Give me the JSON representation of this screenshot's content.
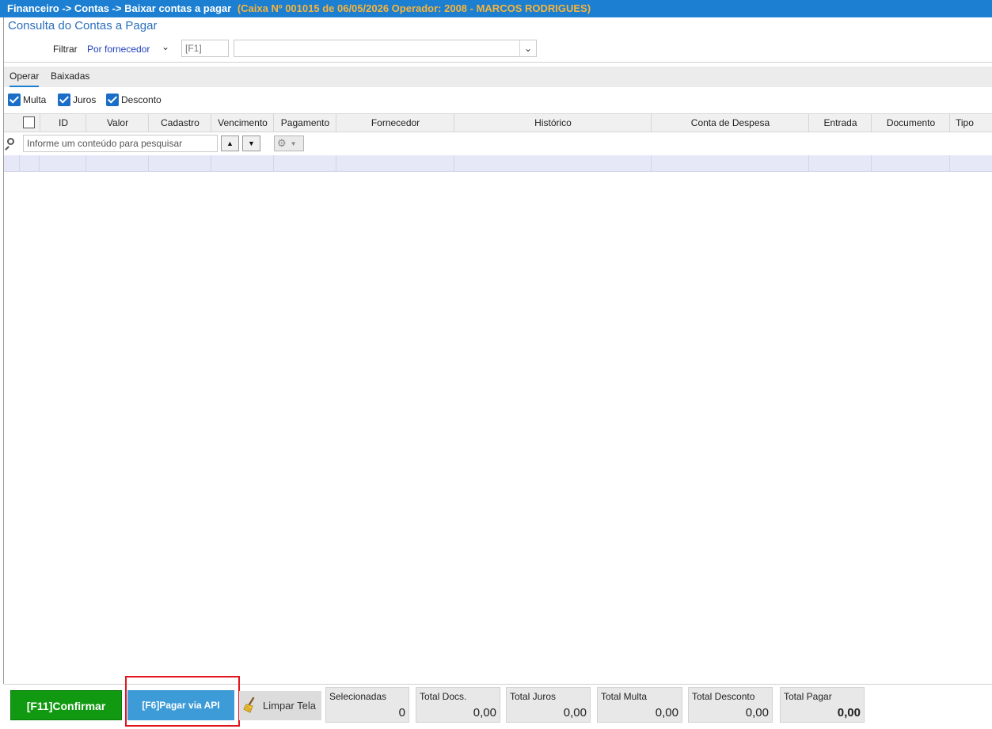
{
  "title_bar": {
    "breadcrumb": "Financeiro -> Contas -> Baixar contas a pagar",
    "session_info": "(Caixa Nº 001015 de 06/05/2026  Operador: 2008 - MARCOS RODRIGUES)"
  },
  "page_title": "Consulta do Contas a Pagar",
  "filter": {
    "label": "Filtrar",
    "mode": "Por fornecedor",
    "shortcut_placeholder": "[F1]",
    "value": ""
  },
  "tabs": [
    "Operar",
    "Baixadas"
  ],
  "checkboxes": [
    {
      "label": "Multa",
      "checked": true
    },
    {
      "label": "Juros",
      "checked": true
    },
    {
      "label": "Desconto",
      "checked": true
    }
  ],
  "grid": {
    "columns": [
      "ID",
      "Valor",
      "Cadastro",
      "Vencimento",
      "Pagamento",
      "Fornecedor",
      "Histórico",
      "Conta de Despesa",
      "Entrada",
      "Documento",
      "Tipo"
    ],
    "search_placeholder": "Informe um conteúdo para pesquisar",
    "rows": []
  },
  "buttons": {
    "confirm": "[F11]Confirmar",
    "pay_api": "[F6]Pagar via API",
    "clear": "Limpar Tela"
  },
  "totals": [
    {
      "label": "Selecionadas",
      "value": "0"
    },
    {
      "label": "Total Docs.",
      "value": "0,00"
    },
    {
      "label": "Total Juros",
      "value": "0,00"
    },
    {
      "label": "Total Multa",
      "value": "0,00"
    },
    {
      "label": "Total Desconto",
      "value": "0,00"
    },
    {
      "label": "Total Pagar",
      "value": "0,00"
    }
  ],
  "colors": {
    "title_bar": "#1c7fd1",
    "session_info": "#f7b43a",
    "confirm_button": "#119a11",
    "api_button": "#3d9bd8",
    "highlight_frame": "#e3141d",
    "selected_row": "#e6e8f8"
  },
  "icons": [
    "search-icon",
    "sort-up-icon",
    "sort-down-icon",
    "gear-icon",
    "broom-icon",
    "chevron-down-icon"
  ]
}
